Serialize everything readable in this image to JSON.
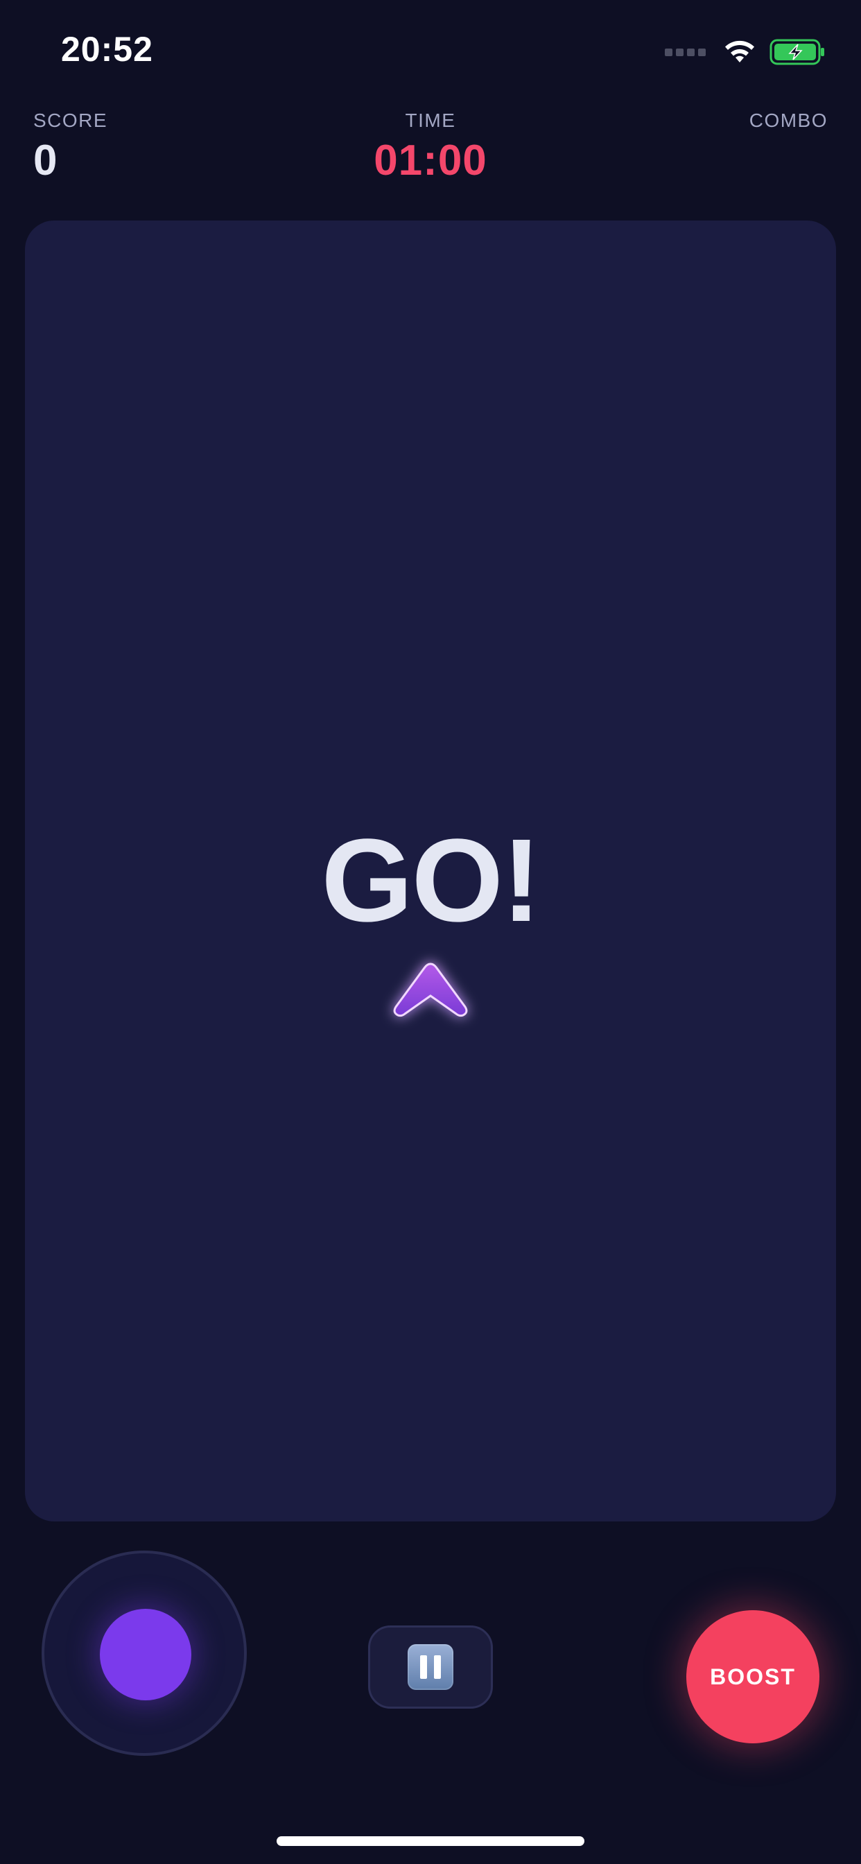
{
  "status_bar": {
    "time": "20:52",
    "wifi_icon": "wifi-icon",
    "battery_icon": "battery-charging-icon",
    "battery_color": "#34c759"
  },
  "hud": {
    "score_label": "SCORE",
    "score_value": "0",
    "time_label": "TIME",
    "time_value": "01:00",
    "combo_label": "COMBO"
  },
  "play_field": {
    "message": "GO!",
    "player_icon": "arrow-ship-icon",
    "player_color": "#9b4de6"
  },
  "controls": {
    "joystick_icon": "joystick-icon",
    "pause_icon": "pause-icon",
    "boost_label": "BOOST"
  },
  "colors": {
    "background": "#0e0f24",
    "field": "#1b1c41",
    "accent_red": "#f4476b",
    "accent_purple": "#7b3aec"
  }
}
